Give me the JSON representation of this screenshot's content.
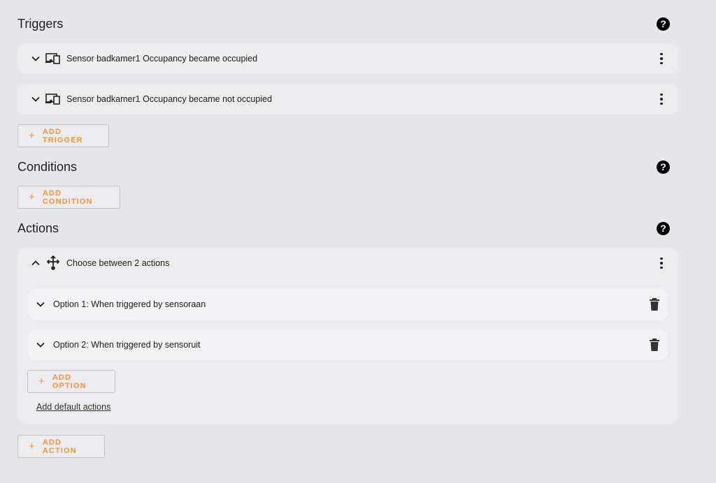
{
  "triggers": {
    "title": "Triggers",
    "items": [
      {
        "label": "Sensor badkamer1 Occupancy became occupied"
      },
      {
        "label": "Sensor badkamer1 Occupancy became not occupied"
      }
    ],
    "add_label": "ADD TRIGGER"
  },
  "conditions": {
    "title": "Conditions",
    "add_label": "ADD CONDITION"
  },
  "actions": {
    "title": "Actions",
    "choose": {
      "label": "Choose between 2 actions",
      "options": [
        {
          "label": "Option 1: When triggered by sensoraan"
        },
        {
          "label": "Option 2: When triggered by sensoruit"
        }
      ],
      "add_option_label": "ADD OPTION",
      "default_link": "Add default actions"
    },
    "add_label": "ADD ACTION"
  },
  "icons": {
    "help": "?",
    "plus": "+"
  },
  "colors": {
    "accent": "#f0953a",
    "background": "#e6e6ea",
    "card": "#ececef"
  }
}
